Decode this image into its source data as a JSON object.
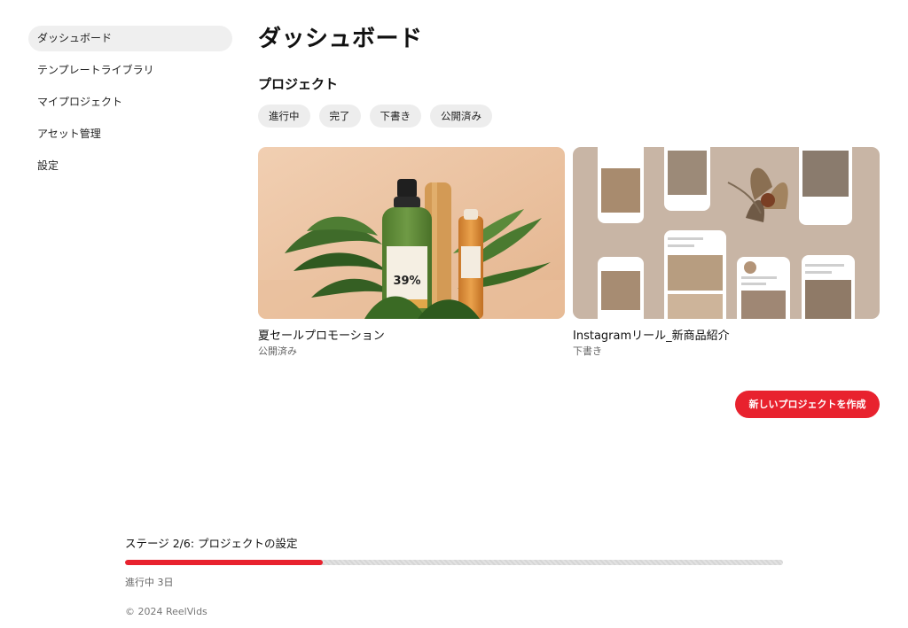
{
  "sidebar": {
    "items": [
      {
        "label": "ダッシュボード",
        "active": true
      },
      {
        "label": "テンプレートライブラリ"
      },
      {
        "label": "マイプロジェクト"
      },
      {
        "label": "アセット管理"
      },
      {
        "label": "設定"
      }
    ]
  },
  "main": {
    "title": "ダッシュボード",
    "section_title": "プロジェクト",
    "filters": [
      "進行中",
      "完了",
      "下書き",
      "公開済み"
    ],
    "projects": [
      {
        "title": "夏セールプロモーション",
        "status": "公開済み",
        "thumbnail": "product-bottle-image",
        "bottle_label": "39%"
      },
      {
        "title": "Instagramリール_新商品紹介",
        "status": "下書き",
        "thumbnail": "phone-mockups-image"
      }
    ],
    "create_button": "新しいプロジェクトを作成"
  },
  "stage": {
    "label": "ステージ 2/6: プロジェクトの設定",
    "progress": 0.3,
    "days": "進行中 3日"
  },
  "footer": "© 2024 ReelVids",
  "colors": {
    "accent": "#e8222e",
    "chip_bg": "#ededed",
    "active_nav_bg": "#efefef"
  }
}
